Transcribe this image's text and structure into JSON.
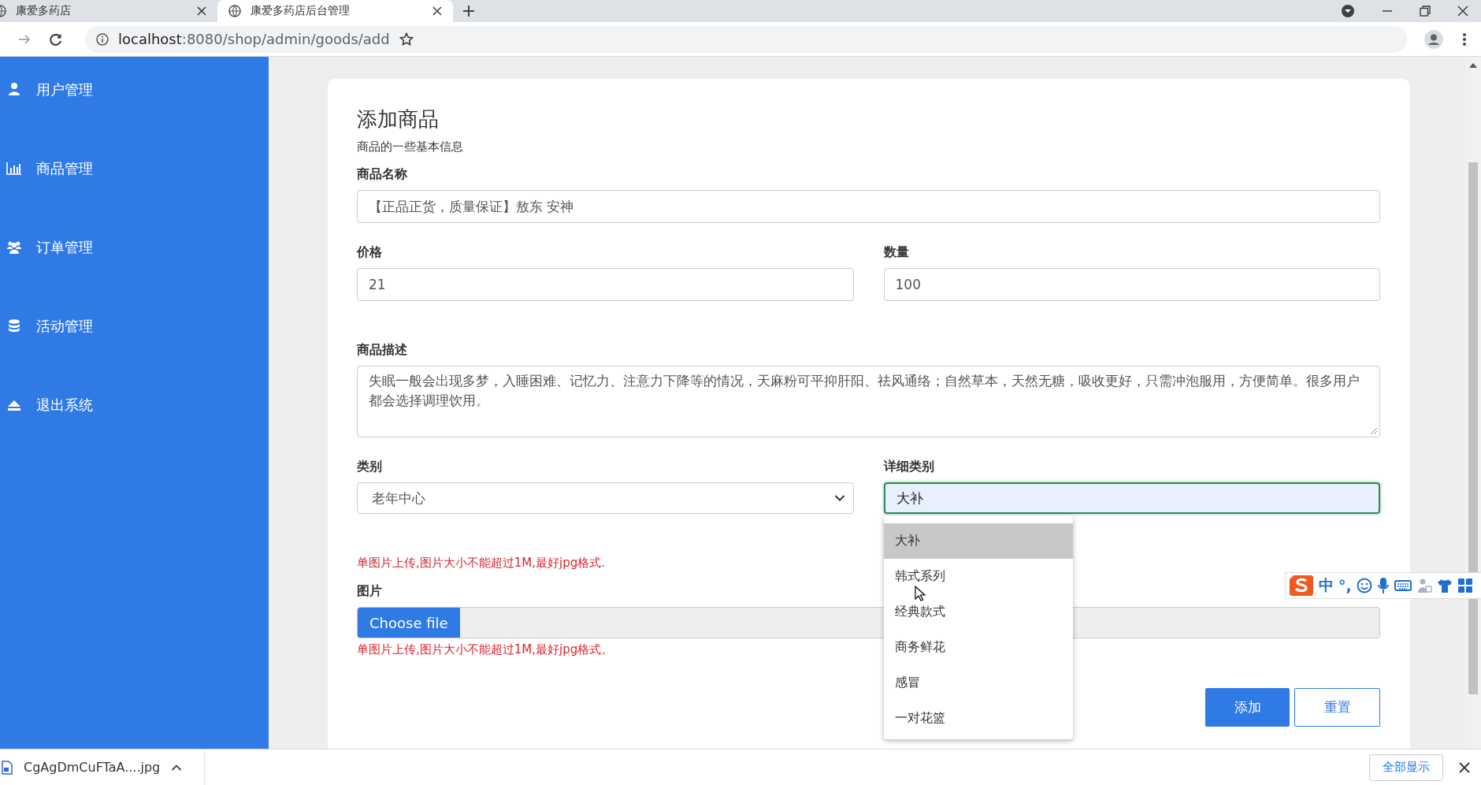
{
  "browser": {
    "tabs": [
      {
        "title": "康爱多药店",
        "selected": false
      },
      {
        "title": "康爱多药店后台管理",
        "selected": true
      }
    ],
    "nav": [
      {
        "kind": "forward",
        "disabled": true
      },
      {
        "kind": "reload",
        "disabled": false
      }
    ],
    "url_host": "localhost",
    "url_path": ":8080/shop/admin/goods/add"
  },
  "sidebar": {
    "items": [
      {
        "label": "用户管理",
        "kind": "user"
      },
      {
        "label": "商品管理",
        "kind": "chart"
      },
      {
        "label": "订单管理",
        "kind": "users"
      },
      {
        "label": "活动管理",
        "kind": "database"
      },
      {
        "label": "退出系统",
        "kind": "eject"
      }
    ]
  },
  "form": {
    "title": "添加商品",
    "subtitle": "商品的一些基本信息",
    "name": {
      "label": "商品名称",
      "value": "【正品正货，质量保证】敖东 安神"
    },
    "price": {
      "label": "价格",
      "value": "21"
    },
    "quantity": {
      "label": "数量",
      "value": "100"
    },
    "description": {
      "label": "商品描述",
      "value": "失眠一般会出现多梦，入睡困难、记忆力、注意力下降等的情况，天麻粉可平抑肝阳、祛风通络；自然草本，天然无糖，吸收更好，只需冲泡服用，方便简单。很多用户都会选择调理饮用。"
    },
    "category": {
      "label": "类别",
      "value": "老年中心"
    },
    "detail_category": {
      "label": "详细类别",
      "value": "大补",
      "focused": true,
      "options": [
        {
          "label": "大补",
          "selected": true
        },
        {
          "label": "韩式系列",
          "selected": false
        },
        {
          "label": "经典款式",
          "selected": false
        },
        {
          "label": "商务鲜花",
          "selected": false
        },
        {
          "label": "感冒",
          "selected": false
        },
        {
          "label": "一对花篮",
          "selected": false
        }
      ]
    },
    "notice_top": "单图片上传,图片大小不能超过1M,最好jpg格式.",
    "image": {
      "label": "图片",
      "button": "Choose file"
    },
    "notice_bottom": "单图片上传,图片大小不能超过1M,最好jpg格式。",
    "buttons": [
      {
        "label": "添加",
        "kind": "primary"
      },
      {
        "label": "重置",
        "kind": "outline"
      }
    ]
  },
  "ime_toolbar": {
    "language": "中",
    "punctuation": "°,"
  },
  "download_bar": {
    "file": "CgAgDmCuFTaA....jpg",
    "show_all": "全部显示"
  }
}
